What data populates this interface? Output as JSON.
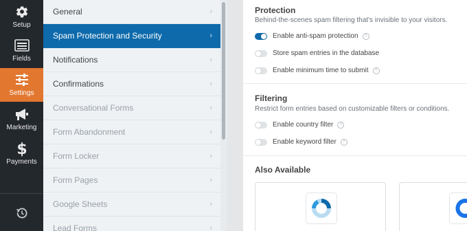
{
  "leftbar": {
    "items": [
      {
        "label": "Setup",
        "icon": "gear-icon"
      },
      {
        "label": "Fields",
        "icon": "fields-list-icon"
      },
      {
        "label": "Settings",
        "icon": "sliders-icon",
        "active": true
      },
      {
        "label": "Marketing",
        "icon": "megaphone-icon"
      },
      {
        "label": "Payments",
        "icon": "dollar-icon"
      }
    ],
    "bottom_icon": "history-icon"
  },
  "menu": {
    "items": [
      {
        "label": "General"
      },
      {
        "label": "Spam Protection and Security"
      },
      {
        "label": "Notifications"
      },
      {
        "label": "Confirmations"
      },
      {
        "label": "Conversational Forms"
      },
      {
        "label": "Form Abandonment"
      },
      {
        "label": "Form Locker"
      },
      {
        "label": "Form Pages"
      },
      {
        "label": "Google Sheets"
      },
      {
        "label": "Lead Forms"
      }
    ],
    "chevron": "›"
  },
  "content": {
    "protection": {
      "title": "Protection",
      "desc": "Behind-the-scenes spam filtering that's invisible to your visitors.",
      "toggles": [
        {
          "label": "Enable anti-spam protection",
          "on": true
        },
        {
          "label": "Store spam entries in the database",
          "on": false
        },
        {
          "label": "Enable minimum time to submit",
          "on": false
        }
      ]
    },
    "filtering": {
      "title": "Filtering",
      "desc": "Restrict form entries based on customizable filters or conditions.",
      "toggles": [
        {
          "label": "Enable country filter",
          "on": false
        },
        {
          "label": "Enable keyword filter",
          "on": false
        }
      ]
    },
    "also_available": {
      "title": "Also Available"
    },
    "help_glyph": "?"
  },
  "colors": {
    "accent_orange": "#e27730",
    "active_blue": "#0e6aab",
    "sidebar_dark": "#23282d"
  }
}
